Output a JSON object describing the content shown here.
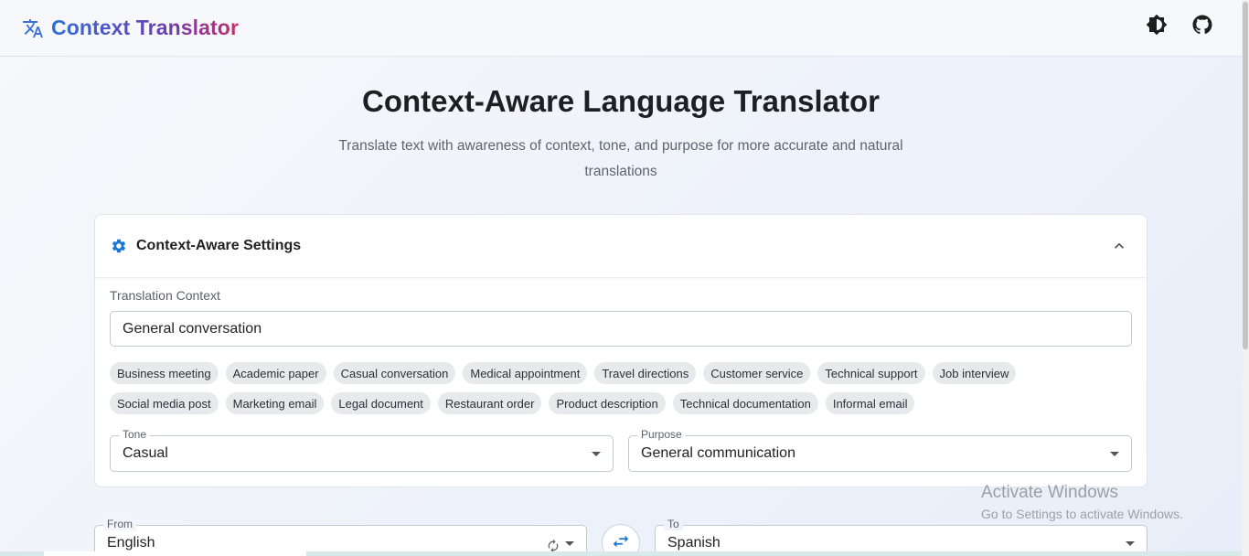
{
  "header": {
    "title": "Context Translator",
    "icons": [
      "translate-icon",
      "theme-toggle-icon",
      "github-icon"
    ]
  },
  "hero": {
    "title": "Context-Aware Language Translator",
    "subtitle": "Translate text with awareness of context, tone, and purpose for more accurate and natural translations"
  },
  "settings": {
    "title": "Context-Aware Settings",
    "context_label": "Translation Context",
    "context_value": "General conversation",
    "chips_row1": [
      "Business meeting",
      "Academic paper",
      "Casual conversation",
      "Medical appointment",
      "Travel directions",
      "Customer service",
      "Technical support",
      "Job interview"
    ],
    "chips_row2": [
      "Social media post",
      "Marketing email",
      "Legal document",
      "Restaurant order",
      "Product description",
      "Technical documentation",
      "Informal email"
    ],
    "tone": {
      "label": "Tone",
      "value": "Casual"
    },
    "purpose": {
      "label": "Purpose",
      "value": "General communication"
    }
  },
  "languages": {
    "from": {
      "label": "From",
      "value": "English"
    },
    "to": {
      "label": "To",
      "value": "Spanish"
    }
  },
  "watermark": {
    "title": "Activate Windows",
    "subtitle": "Go to Settings to activate Windows."
  },
  "colors": {
    "accent": "#1976d2",
    "brand_gradient": [
      "#2f6fd6",
      "#6a3fb5",
      "#c2306b"
    ]
  }
}
